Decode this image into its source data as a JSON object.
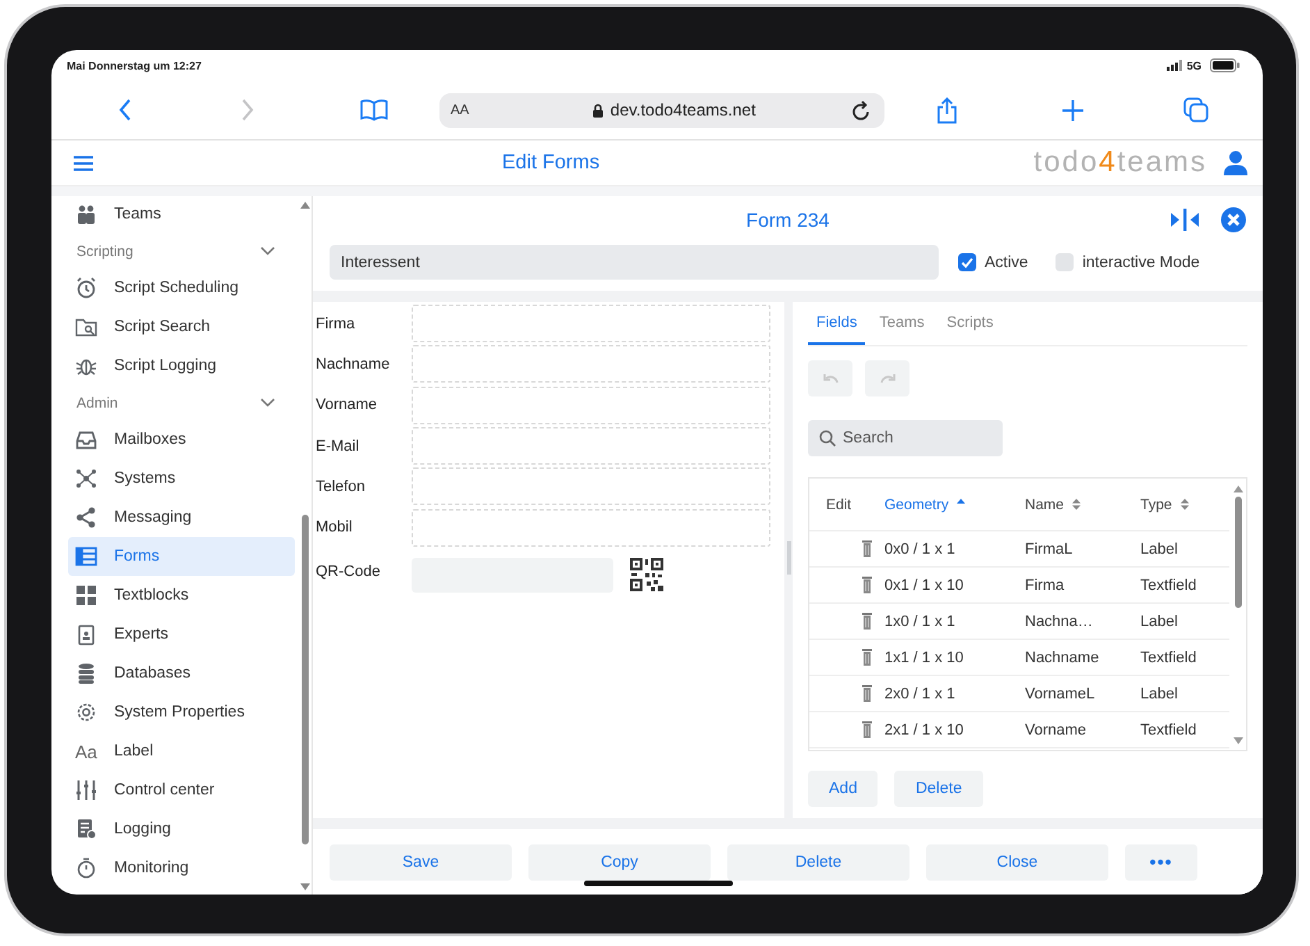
{
  "status_bar": {
    "time": "Mai Donnerstag um 12:27",
    "network": "5G"
  },
  "browser": {
    "reader": "AA",
    "url": "dev.todo4teams.net"
  },
  "header": {
    "title": "Edit Forms",
    "logo": [
      {
        "text": "todo",
        "accent": false
      },
      {
        "text": "4",
        "accent": true
      },
      {
        "text": "teams",
        "accent": false
      }
    ]
  },
  "sidebar": {
    "items": [
      {
        "kind": "item",
        "label": "Teams",
        "selected": false
      },
      {
        "kind": "section",
        "label": "Scripting",
        "expanded": true
      },
      {
        "kind": "item",
        "label": "Script Scheduling",
        "selected": false
      },
      {
        "kind": "item",
        "label": "Script Search",
        "selected": false
      },
      {
        "kind": "item",
        "label": "Script Logging",
        "selected": false
      },
      {
        "kind": "section",
        "label": "Admin",
        "expanded": true
      },
      {
        "kind": "item",
        "label": "Mailboxes",
        "selected": false
      },
      {
        "kind": "item",
        "label": "Systems",
        "selected": false
      },
      {
        "kind": "item",
        "label": "Messaging",
        "selected": false
      },
      {
        "kind": "item",
        "label": "Forms",
        "selected": true
      },
      {
        "kind": "item",
        "label": "Textblocks",
        "selected": false
      },
      {
        "kind": "item",
        "label": "Experts",
        "selected": false
      },
      {
        "kind": "item",
        "label": "Databases",
        "selected": false
      },
      {
        "kind": "item",
        "label": "System Properties",
        "selected": false
      },
      {
        "kind": "item",
        "label": "Label",
        "selected": false,
        "glyph": "Aa"
      },
      {
        "kind": "item",
        "label": "Control center",
        "selected": false
      },
      {
        "kind": "item",
        "label": "Logging",
        "selected": false
      },
      {
        "kind": "item",
        "label": "Monitoring",
        "selected": false
      }
    ]
  },
  "form": {
    "title": "Form 234",
    "name": "Interessent",
    "options": [
      {
        "label": "Active",
        "checked": true
      },
      {
        "label": "interactive Mode",
        "checked": false
      }
    ],
    "fields": [
      {
        "kind": "text",
        "label": "Firma"
      },
      {
        "kind": "text",
        "label": "Nachname"
      },
      {
        "kind": "text",
        "label": "Vorname"
      },
      {
        "kind": "text",
        "label": "E-Mail"
      },
      {
        "kind": "text",
        "label": "Telefon"
      },
      {
        "kind": "text",
        "label": "Mobil"
      },
      {
        "kind": "qr",
        "label": "QR-Code"
      }
    ]
  },
  "tabs": [
    {
      "label": "Fields",
      "selected": true
    },
    {
      "label": "Teams",
      "selected": false
    },
    {
      "label": "Scripts",
      "selected": false
    }
  ],
  "undo": {
    "disabled": true
  },
  "redo": {
    "disabled": true
  },
  "search": {
    "placeholder": "Search"
  },
  "table": {
    "columns": [
      {
        "label": "Edit",
        "sortable": false,
        "sorted": false
      },
      {
        "label": "Geometry",
        "sortable": true,
        "sorted": true
      },
      {
        "label": "Name",
        "sortable": true,
        "sorted": false
      },
      {
        "label": "Type",
        "sortable": true,
        "sorted": false
      }
    ],
    "rows": [
      {
        "geometry": "0x0 / 1 x 1",
        "name": "FirmaL",
        "type": "Label"
      },
      {
        "geometry": "0x1 / 1 x 10",
        "name": "Firma",
        "type": "Textfield"
      },
      {
        "geometry": "1x0 / 1 x 1",
        "name": "Nachna…",
        "type": "Label"
      },
      {
        "geometry": "1x1 / 1 x 10",
        "name": "Nachname",
        "type": "Textfield"
      },
      {
        "geometry": "2x0 / 1 x 1",
        "name": "VornameL",
        "type": "Label"
      },
      {
        "geometry": "2x1 / 1 x 10",
        "name": "Vorname",
        "type": "Textfield"
      }
    ]
  },
  "table_buttons": [
    "Add",
    "Delete"
  ],
  "actions": [
    "Save",
    "Copy",
    "Delete",
    "Close"
  ],
  "more": "•••"
}
